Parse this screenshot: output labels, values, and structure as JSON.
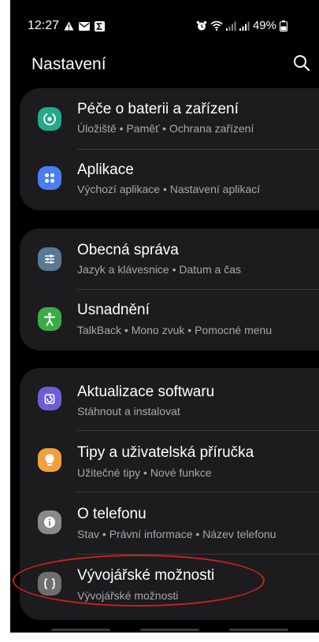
{
  "status_bar": {
    "time": "12:27",
    "battery": "49%",
    "left_icons": [
      "alert-triangle-icon",
      "mail-icon",
      "sigma-icon"
    ],
    "right_icons": [
      "alarm-icon",
      "wifi-icon",
      "signal-icon",
      "signal-icon",
      "battery-icon"
    ]
  },
  "header": {
    "title": "Nastavení",
    "search_icon": "search-icon"
  },
  "groups": [
    {
      "items": [
        {
          "title": "Péče o baterii a zařízení",
          "subtitle": "Úložiště • Paměť • Ochrana zařízení",
          "icon": "device-care-icon",
          "icon_color": "#26a88a"
        },
        {
          "title": "Aplikace",
          "subtitle": "Výchozí aplikace • Nastavení aplikací",
          "icon": "apps-icon",
          "icon_color": "#4a7ff0"
        }
      ]
    },
    {
      "items": [
        {
          "title": "Obecná správa",
          "subtitle": "Jazyk a klávesnice • Datum a čas",
          "icon": "sliders-icon",
          "icon_color": "#5a7892"
        },
        {
          "title": "Usnadnění",
          "subtitle": "TalkBack • Mono zvuk • Pomocné menu",
          "icon": "accessibility-icon",
          "icon_color": "#3daa4a"
        }
      ]
    },
    {
      "items": [
        {
          "title": "Aktualizace softwaru",
          "subtitle": "Stáhnout a instalovat",
          "icon": "software-update-icon",
          "icon_color": "#6c5fd6"
        },
        {
          "title": "Tipy a uživatelská příručka",
          "subtitle": "Užitečné tipy • Nové funkce",
          "icon": "lightbulb-icon",
          "icon_color": "#f0a03c"
        },
        {
          "title": "O telefonu",
          "subtitle": "Stav • Právní informace • Název telefonu",
          "icon": "info-icon",
          "icon_color": "#8a8a8a"
        },
        {
          "title": "Vývojářské možnosti",
          "subtitle": "Vývojářské možnosti",
          "icon": "developer-braces-icon",
          "icon_color": "#6e6e6e"
        }
      ]
    }
  ],
  "annotation": {
    "highlight_color": "#c91f1f",
    "highlighted_item": "Vývojářské možnosti"
  }
}
